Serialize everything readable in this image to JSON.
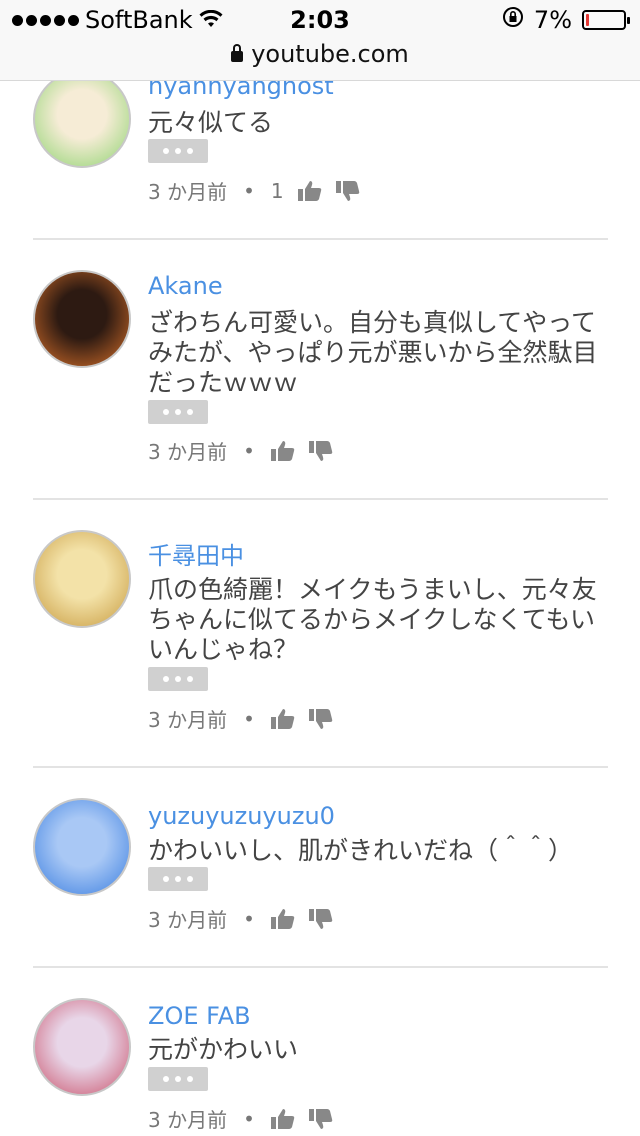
{
  "status_bar": {
    "carrier": "SoftBank",
    "time": "2:03",
    "battery_percent": "7%",
    "battery_level": 0.07
  },
  "address_bar": {
    "url": "youtube.com"
  },
  "comments": [
    {
      "author": "nyannyanghost",
      "text": "元々似てる",
      "time": "3 か月前",
      "likes": "1",
      "avatar_colors": [
        "#f6ecd6",
        "#8dd36f"
      ]
    },
    {
      "author": "Akane",
      "text": "ざわちん可愛い。自分も真似してやってみたが、やっぱり元が悪いから全然駄目だったｗｗｗ",
      "time": "3 か月前",
      "likes": "",
      "avatar_colors": [
        "#2d1a12",
        "#d8702a"
      ]
    },
    {
      "author": "千尋田中",
      "text": "爪の色綺麗！メイクもうまいし、元々友ちゃんに似てるからメイクしなくてもいいんじゃね？",
      "time": "3 か月前",
      "likes": "",
      "avatar_colors": [
        "#f3e2a8",
        "#c79a3e"
      ]
    },
    {
      "author": "yuzuyuzuyuzu0",
      "text": "かわいいし、肌がきれいだね（＾＾）",
      "time": "3 か月前",
      "likes": "",
      "avatar_colors": [
        "#a9c8f5",
        "#3a7ee0"
      ]
    },
    {
      "author": "ZOE FAB",
      "text": "元がかわいい",
      "time": "3 か月前",
      "likes": "",
      "avatar_colors": [
        "#e8d6e8",
        "#c9516a"
      ]
    }
  ]
}
